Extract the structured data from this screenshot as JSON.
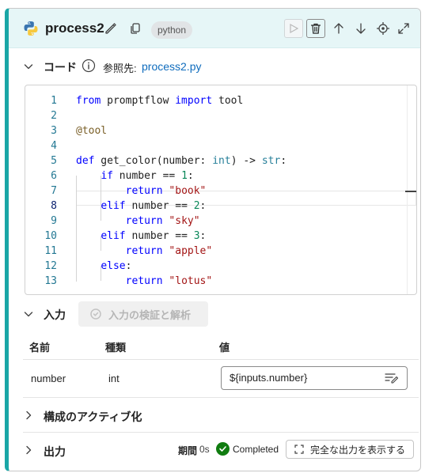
{
  "node": {
    "name": "process2",
    "language_badge": "python"
  },
  "header_icons": [
    "python-logo-icon",
    "pencil-icon",
    "copy-icon",
    "play-icon",
    "trash-icon",
    "arrow-up-icon",
    "arrow-down-icon",
    "target-icon",
    "expand-icon"
  ],
  "code_section": {
    "title": "コード",
    "ref_label": "参照先:",
    "ref_file": "process2.py"
  },
  "code": {
    "active_line": 8,
    "lines": [
      {
        "n": "1",
        "text": "from promptflow import tool"
      },
      {
        "n": "2",
        "text": ""
      },
      {
        "n": "3",
        "text": "@tool"
      },
      {
        "n": "4",
        "text": ""
      },
      {
        "n": "5",
        "text": "def get_color(number: int) -> str:"
      },
      {
        "n": "6",
        "text": "    if number == 1:"
      },
      {
        "n": "7",
        "text": "        return \"book\""
      },
      {
        "n": "8",
        "text": "    elif number == 2:"
      },
      {
        "n": "9",
        "text": "        return \"sky\""
      },
      {
        "n": "10",
        "text": "    elif number == 3:"
      },
      {
        "n": "11",
        "text": "        return \"apple\""
      },
      {
        "n": "12",
        "text": "    else:"
      },
      {
        "n": "13",
        "text": "        return \"lotus\""
      }
    ]
  },
  "inputs_section": {
    "title": "入力",
    "verify_button": "入力の検証と解析",
    "columns": [
      "名前",
      "種類",
      "値"
    ],
    "rows": [
      {
        "name": "number",
        "type": "int",
        "value": "${inputs.number}"
      }
    ]
  },
  "activation_section": {
    "title": "構成のアクティブ化"
  },
  "output_section": {
    "title": "出力",
    "duration_label": "期間",
    "duration_value": "0s",
    "status": "Completed",
    "show_output_button": "完全な出力を表示する"
  },
  "colors": {
    "accent": "#1aa6a6",
    "header_bg": "#e6f6f7",
    "status_success": "#107c10",
    "link": "#0f6cbd"
  }
}
